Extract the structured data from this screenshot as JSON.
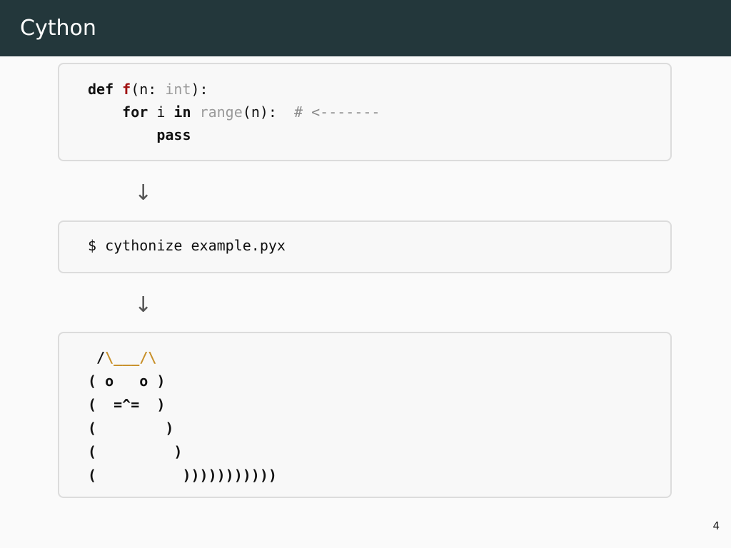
{
  "slide": {
    "title": "Cython",
    "page_number": "4"
  },
  "code_block": {
    "line1": {
      "kw_def": "def",
      "sp1": " ",
      "fn_name": "f",
      "paren_open": "(n: ",
      "type_int": "int",
      "paren_close": "):"
    },
    "line2": {
      "indent": "    ",
      "kw_for": "for",
      "mid": " i ",
      "kw_in": "in",
      "sp": " ",
      "builtin_range": "range",
      "rest": "(n):  ",
      "comment": "# <-------"
    },
    "line3": {
      "indent": "        ",
      "kw_pass": "pass"
    }
  },
  "arrows": {
    "down_1": "↓",
    "down_2": "↓"
  },
  "command_block": {
    "command": "$ cythonize example.pyx"
  },
  "ascii_art": {
    "l1_a": " /",
    "l1_b": "\\___/\\",
    "l2": "( o   o )",
    "l3": "(  =^=  )",
    "l4": "(        )",
    "l5": "(         )",
    "l6": "(          )))))))))))"
  }
}
